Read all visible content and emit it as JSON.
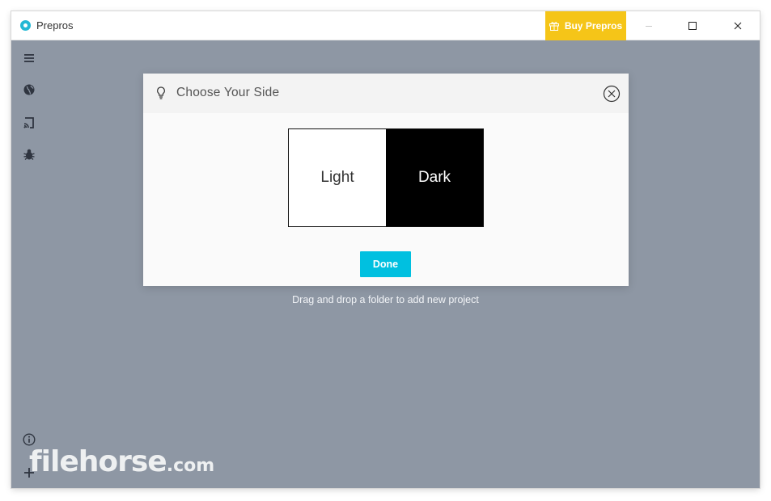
{
  "window": {
    "title": "Prepros",
    "buy_label": "Buy Prepros",
    "minimize_icon": "minimize-icon",
    "maximize_icon": "maximize-icon",
    "close_icon": "close-icon"
  },
  "sidebar": {
    "items": [
      {
        "icon": "menu-icon"
      },
      {
        "icon": "globe-icon"
      },
      {
        "icon": "cast-icon"
      },
      {
        "icon": "bug-icon"
      }
    ],
    "bottom_items": [
      {
        "icon": "info-icon"
      },
      {
        "icon": "add-icon"
      }
    ]
  },
  "main": {
    "dropzone_hint": "Drag and drop a folder to add new project"
  },
  "modal": {
    "title": "Choose Your Side",
    "options": [
      {
        "label": "Light"
      },
      {
        "label": "Dark"
      }
    ],
    "done_label": "Done"
  },
  "watermark": {
    "text": "filehorse",
    "suffix": ".com"
  },
  "colors": {
    "accent": "#00c0e0",
    "buy": "#f5c518",
    "background": "#8e97a4"
  }
}
